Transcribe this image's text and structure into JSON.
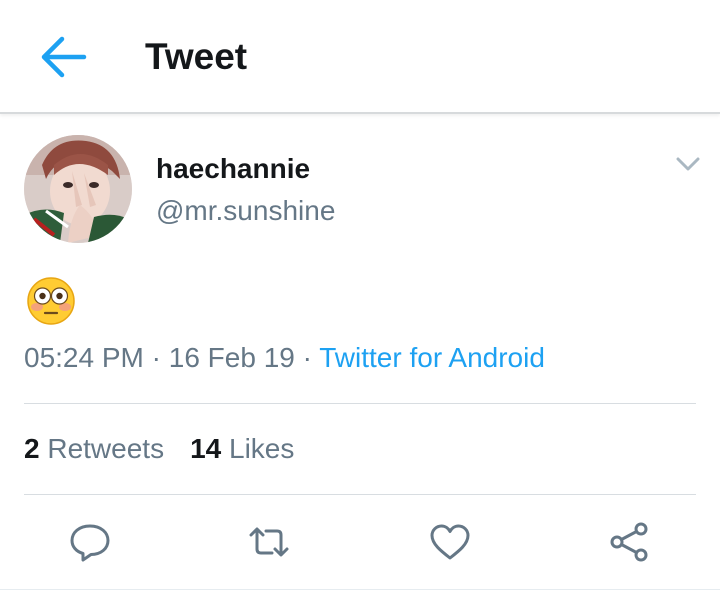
{
  "header": {
    "title": "Tweet",
    "back_icon": "arrow-left-icon",
    "accent_color": "#1da1f2"
  },
  "tweet": {
    "display_name": "haechannie",
    "handle": "@mr.sunshine",
    "menu_icon": "chevron-down-icon",
    "content_emoji": "flushed-face-emoji",
    "time": "05:24 PM",
    "separator": " · ",
    "date": "16 Feb 19",
    "source": "Twitter for Android",
    "retweets_count": "2",
    "retweets_label": "Retweets",
    "likes_count": "14",
    "likes_label": "Likes"
  },
  "actions": [
    {
      "icon": "reply-icon"
    },
    {
      "icon": "retweet-icon"
    },
    {
      "icon": "like-heart-icon"
    },
    {
      "icon": "share-icon"
    }
  ],
  "colors": {
    "text_primary": "#14171a",
    "text_secondary": "#657786",
    "link": "#1da1f2",
    "divider": "#d8dde1"
  }
}
